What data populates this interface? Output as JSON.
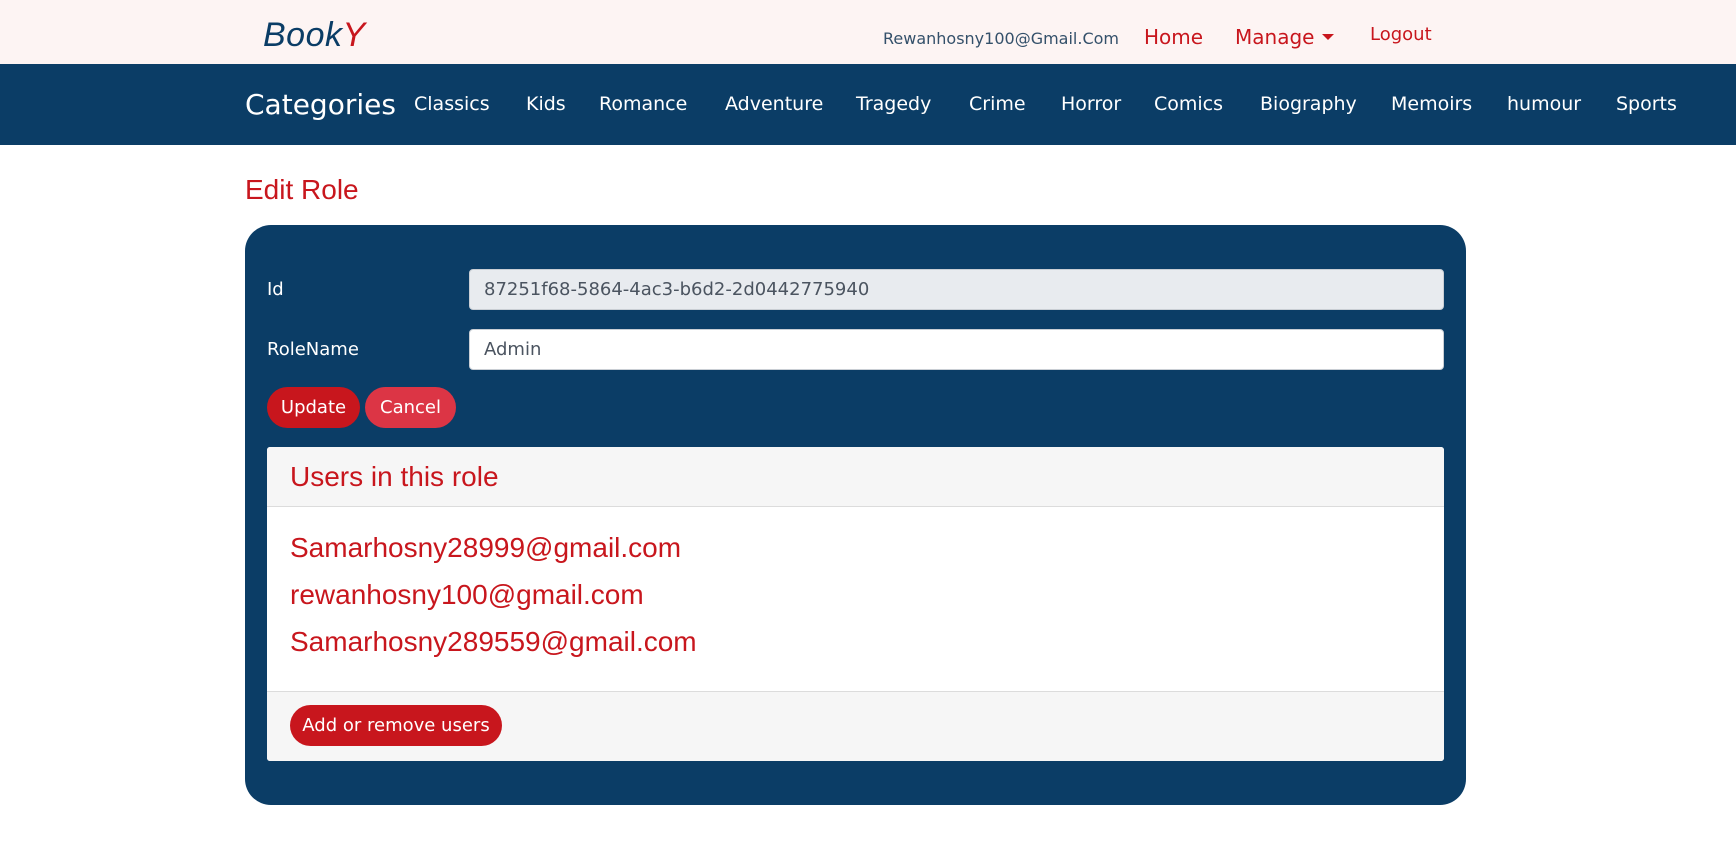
{
  "brand": {
    "part1": "Book",
    "part2": "Y"
  },
  "header": {
    "user_email": "Rewanhosny100@Gmail.Com",
    "home_label": "Home",
    "manage_label": "Manage",
    "logout_label": "Logout"
  },
  "categories": {
    "title": "Categories",
    "items": [
      "Classics",
      "Kids",
      "Romance",
      "Adventure",
      "Tragedy",
      "Crime",
      "Horror",
      "Comics",
      "Biography",
      "Memoirs",
      "humour",
      "Sports"
    ]
  },
  "page": {
    "title": "Edit Role"
  },
  "form": {
    "id_label": "Id",
    "id_value": "87251f68-5864-4ac3-b6d2-2d0442775940",
    "rolename_label": "RoleName",
    "rolename_value": "Admin",
    "update_label": "Update",
    "cancel_label": "Cancel"
  },
  "users_card": {
    "title": "Users in this role",
    "users": [
      "Samarhosny28999@gmail.com",
      "rewanhosny100@gmail.com",
      "Samarhosny289559@gmail.com"
    ],
    "add_remove_label": "Add or remove users"
  },
  "colors": {
    "primary": "#0b3d66",
    "accent": "#c8161d",
    "cancel": "#dc3545",
    "topbar_bg": "#fdf4f3"
  }
}
